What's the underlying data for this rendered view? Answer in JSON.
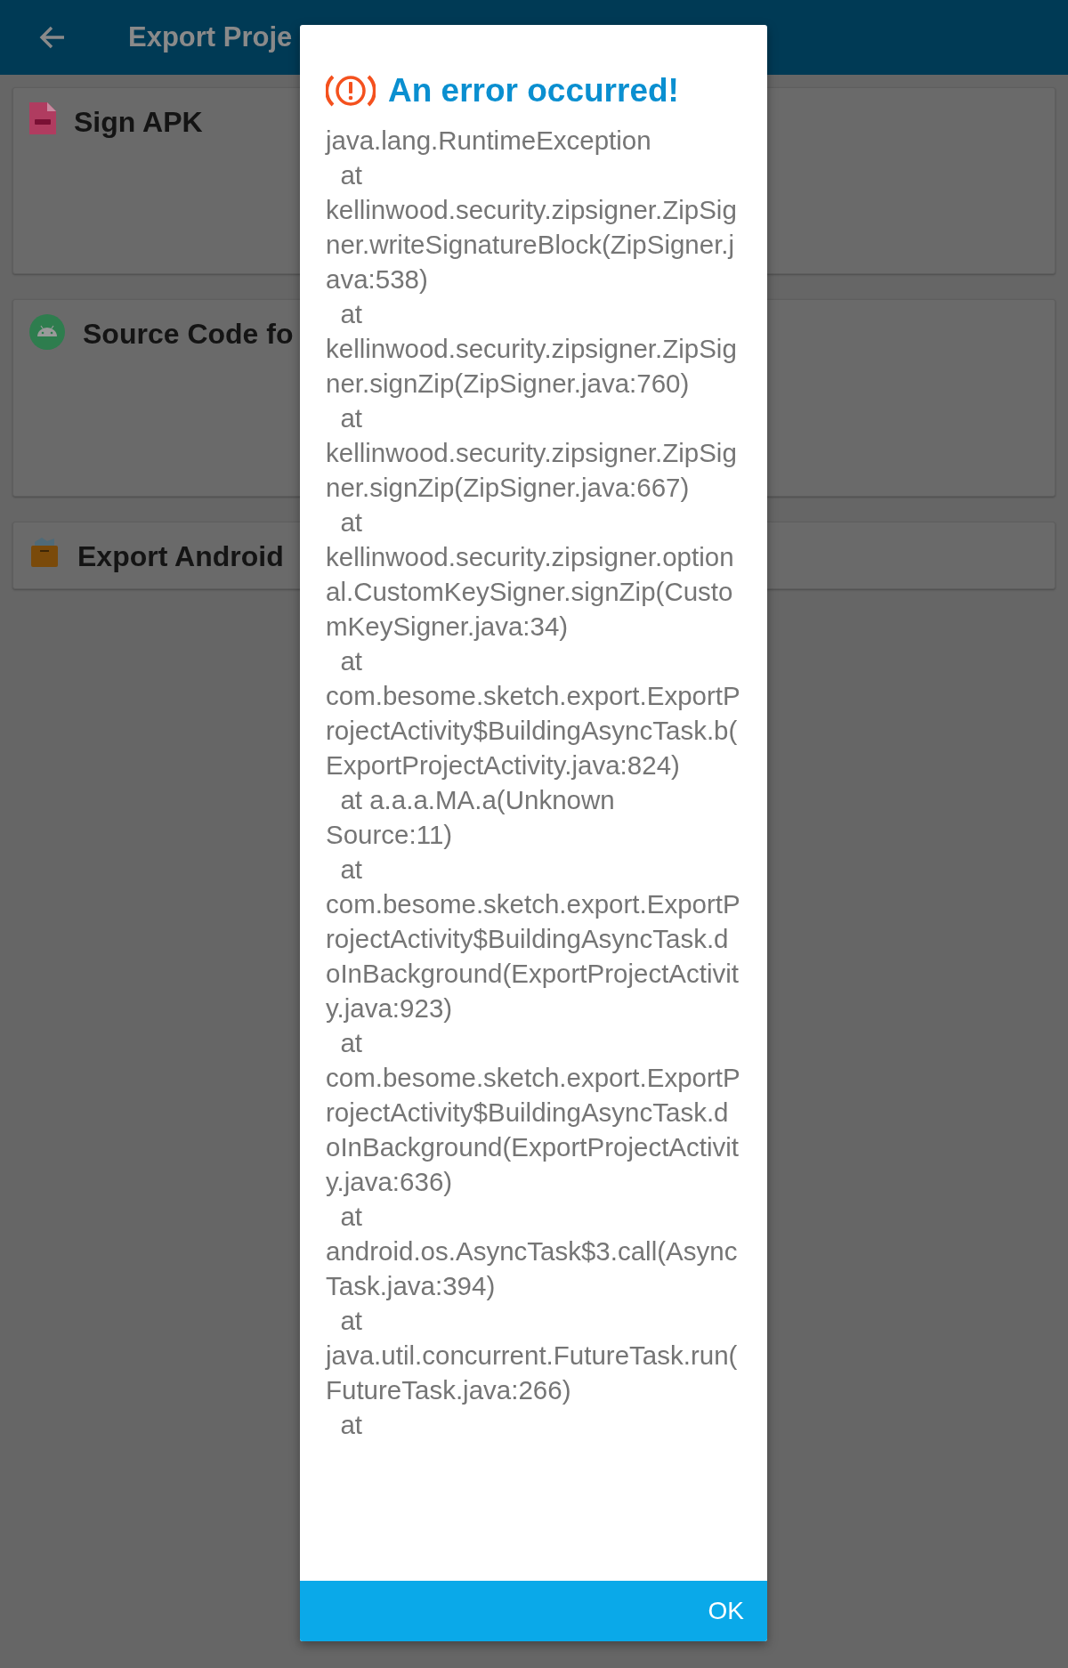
{
  "app_bar": {
    "title": "Export Proje"
  },
  "cards": [
    {
      "title": "Sign APK",
      "kind": "apk"
    },
    {
      "title": "Source Code fo",
      "kind": "android"
    },
    {
      "title": "Export Android",
      "kind": "box"
    }
  ],
  "dialog": {
    "title": "An error occurred!",
    "message": "java.lang.RuntimeException\n  at kellinwood.security.zipsigner.ZipSigner.writeSignatureBlock(ZipSigner.java:538)\n  at kellinwood.security.zipsigner.ZipSigner.signZip(ZipSigner.java:760)\n  at kellinwood.security.zipsigner.ZipSigner.signZip(ZipSigner.java:667)\n  at kellinwood.security.zipsigner.optional.CustomKeySigner.signZip(CustomKeySigner.java:34)\n  at com.besome.sketch.export.ExportProjectActivity$BuildingAsyncTask.b(ExportProjectActivity.java:824)\n  at a.a.a.MA.a(Unknown Source:11)\n  at com.besome.sketch.export.ExportProjectActivity$BuildingAsyncTask.doInBackground(ExportProjectActivity.java:923)\n  at com.besome.sketch.export.ExportProjectActivity$BuildingAsyncTask.doInBackground(ExportProjectActivity.java:636)\n  at android.os.AsyncTask$3.call(AsyncTask.java:394)\n  at java.util.concurrent.FutureTask.run(FutureTask.java:266)\n  at",
    "buttons": [
      "OK"
    ]
  }
}
